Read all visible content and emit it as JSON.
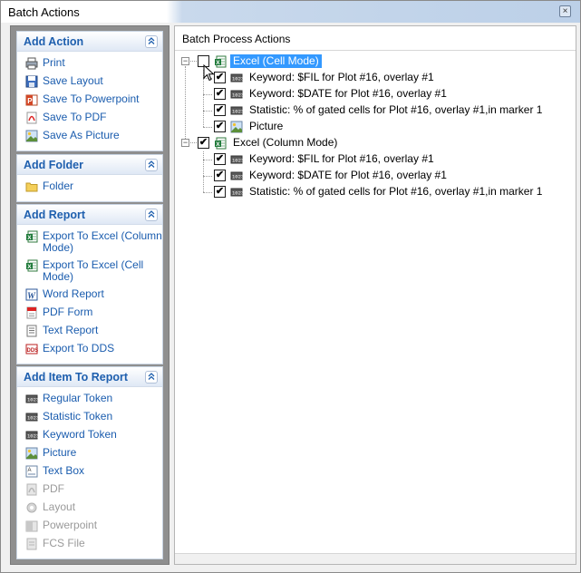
{
  "window": {
    "title": "Batch Actions",
    "close_glyph": "×"
  },
  "colors": {
    "accent": "#1e5fae",
    "selection": "#3399ff",
    "panel_bg": "#8f8f8f"
  },
  "sidebar": {
    "groups": [
      {
        "title": "Add Action",
        "items": [
          {
            "label": "Print",
            "icon": "printer-icon",
            "enabled": true
          },
          {
            "label": "Save Layout",
            "icon": "save-icon",
            "enabled": true
          },
          {
            "label": "Save To Powerpoint",
            "icon": "powerpoint-icon",
            "enabled": true
          },
          {
            "label": "Save To PDF",
            "icon": "pdf-icon",
            "enabled": true
          },
          {
            "label": "Save As Picture",
            "icon": "picture-icon",
            "enabled": true
          }
        ]
      },
      {
        "title": "Add Folder",
        "items": [
          {
            "label": "Folder",
            "icon": "folder-icon",
            "enabled": true
          }
        ]
      },
      {
        "title": "Add Report",
        "items": [
          {
            "label": "Export To Excel (Column Mode)",
            "icon": "excel-icon",
            "enabled": true
          },
          {
            "label": "Export To Excel (Cell Mode)",
            "icon": "excel-icon",
            "enabled": true
          },
          {
            "label": "Word Report",
            "icon": "word-icon",
            "enabled": true
          },
          {
            "label": "PDF Form",
            "icon": "pdf-form-icon",
            "enabled": true
          },
          {
            "label": "Text Report",
            "icon": "text-report-icon",
            "enabled": true
          },
          {
            "label": "Export To DDS",
            "icon": "dds-icon",
            "enabled": true
          }
        ]
      },
      {
        "title": "Add Item To Report",
        "items": [
          {
            "label": "Regular Token",
            "icon": "token-icon",
            "enabled": true
          },
          {
            "label": "Statistic Token",
            "icon": "token-icon",
            "enabled": true
          },
          {
            "label": "Keyword Token",
            "icon": "token-icon",
            "enabled": true
          },
          {
            "label": "Picture",
            "icon": "picture-icon",
            "enabled": true
          },
          {
            "label": "Text Box",
            "icon": "textbox-icon",
            "enabled": true
          },
          {
            "label": "PDF",
            "icon": "pdf-disabled-icon",
            "enabled": false
          },
          {
            "label": "Layout",
            "icon": "layout-disabled-icon",
            "enabled": false
          },
          {
            "label": "Powerpoint",
            "icon": "powerpoint-disabled-icon",
            "enabled": false
          },
          {
            "label": "FCS File",
            "icon": "fcs-file-icon",
            "enabled": false
          }
        ]
      }
    ]
  },
  "main": {
    "header": "Batch Process Actions",
    "tree": [
      {
        "label": "Excel (Cell Mode)",
        "checked": false,
        "expanded": true,
        "selected": true,
        "icon": "excel-icon",
        "children": [
          {
            "label": "Keyword: $FIL for Plot #16, overlay #1",
            "checked": true,
            "icon": "token-icon"
          },
          {
            "label": "Keyword: $DATE for Plot #16, overlay #1",
            "checked": true,
            "icon": "token-icon"
          },
          {
            "label": "Statistic: % of gated cells for Plot #16, overlay #1,in marker 1",
            "checked": true,
            "icon": "token-icon"
          },
          {
            "label": "Picture",
            "checked": true,
            "icon": "picture-icon"
          }
        ]
      },
      {
        "label": "Excel (Column Mode)",
        "checked": true,
        "expanded": true,
        "selected": false,
        "icon": "excel-icon",
        "children": [
          {
            "label": "Keyword: $FIL for Plot #16, overlay #1",
            "checked": true,
            "icon": "token-icon"
          },
          {
            "label": "Keyword: $DATE for Plot #16, overlay #1",
            "checked": true,
            "icon": "token-icon"
          },
          {
            "label": "Statistic: % of gated cells for Plot #16, overlay #1,in marker 1",
            "checked": true,
            "icon": "token-icon"
          }
        ]
      }
    ],
    "expander_glyph": "−",
    "check_glyph": "✔"
  }
}
